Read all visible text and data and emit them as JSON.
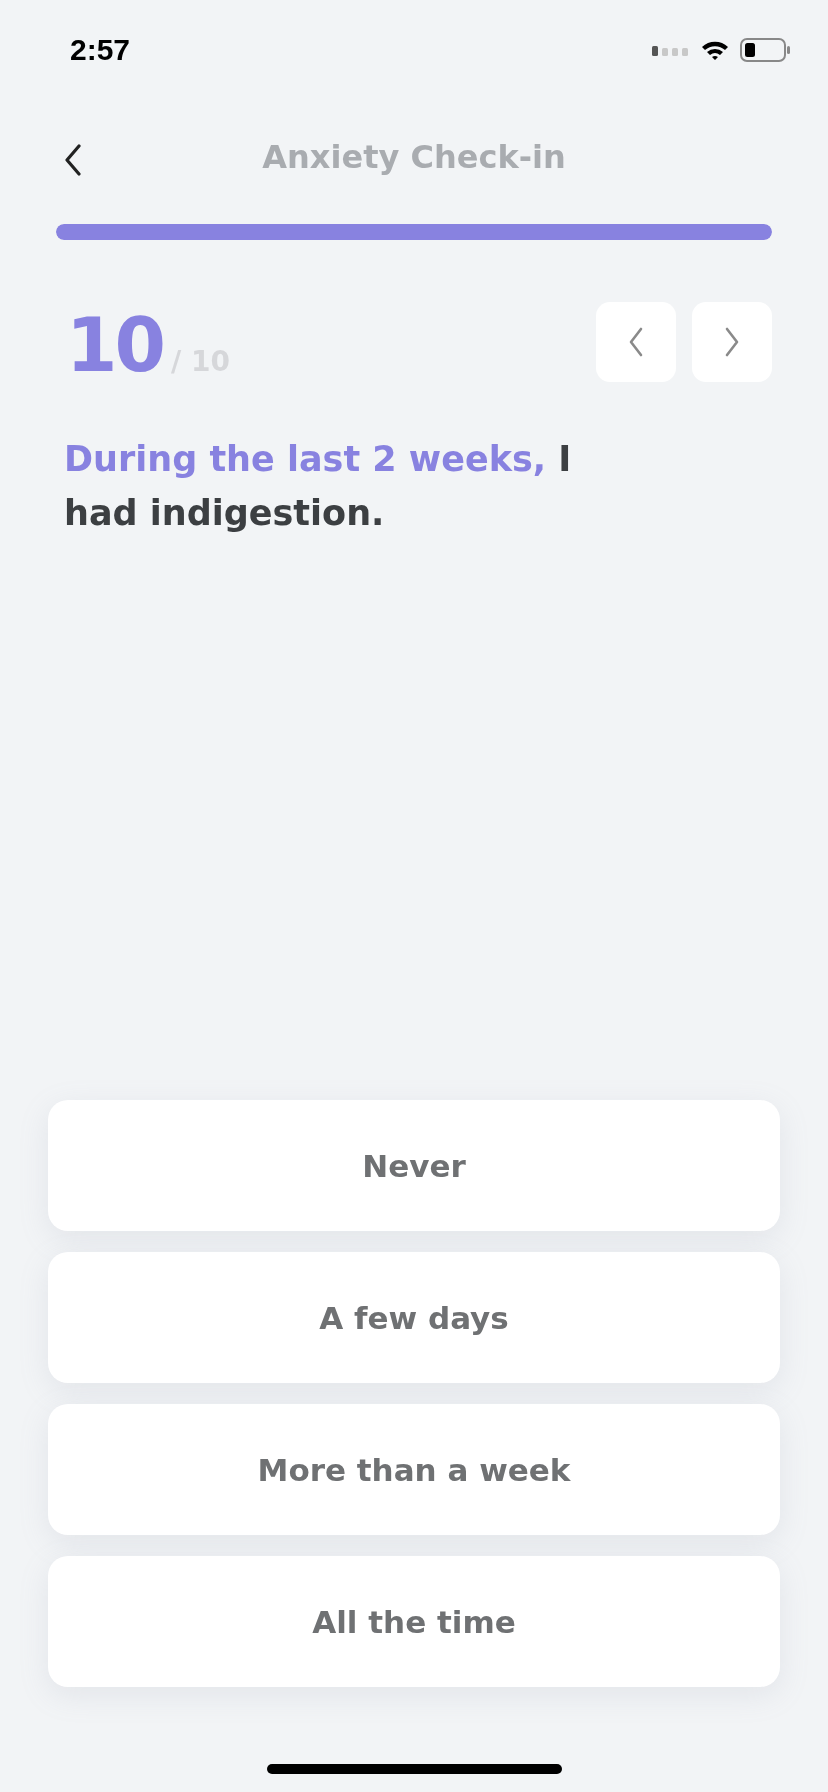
{
  "status_bar": {
    "time": "2:57"
  },
  "header": {
    "title": "Anxiety Check-in"
  },
  "progress": {
    "level": 1.0
  },
  "counter": {
    "current": "10",
    "total": "/ 10"
  },
  "question": {
    "lead": "During the last 2 weeks,",
    "text": "I had indigestion."
  },
  "options": [
    {
      "label": "Never"
    },
    {
      "label": "A few days"
    },
    {
      "label": "More than a week"
    },
    {
      "label": "All the time"
    }
  ]
}
